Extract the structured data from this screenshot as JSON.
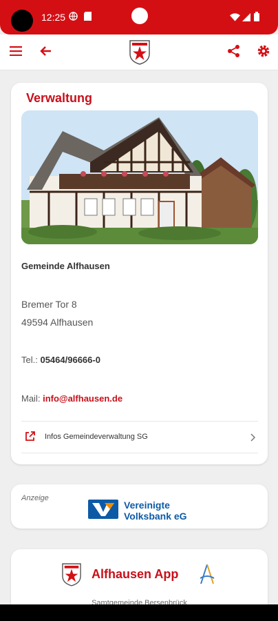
{
  "status_bar": {
    "time": "12:25"
  },
  "colors": {
    "brand_red": "#d40f14",
    "volksbank_blue": "#0c5aa6"
  },
  "app_bar": {
    "menu_icon": "hamburger-menu-icon",
    "back_icon": "arrow-left-icon",
    "logo": "crest-logo",
    "share_icon": "share-icon",
    "settings_icon": "gear-icon"
  },
  "main_card": {
    "title": "Verwaltung",
    "organization": "Gemeinde Alfhausen",
    "street": "Bremer Tor 8",
    "city": "49594 Alfhausen",
    "phone_label": "Tel.:",
    "phone": "05464/96666-0",
    "mail_label": "Mail:",
    "mail": "info@alfhausen.de",
    "link_label": "Infos Gemeindeverwaltung SG"
  },
  "ad_card": {
    "label": "Anzeige",
    "brand_line1": "Vereinigte",
    "brand_line2": "Volksbank eG"
  },
  "app_card": {
    "title": "Alfhausen App",
    "subtitle": "Samtgemeinde Bersenbrück"
  }
}
